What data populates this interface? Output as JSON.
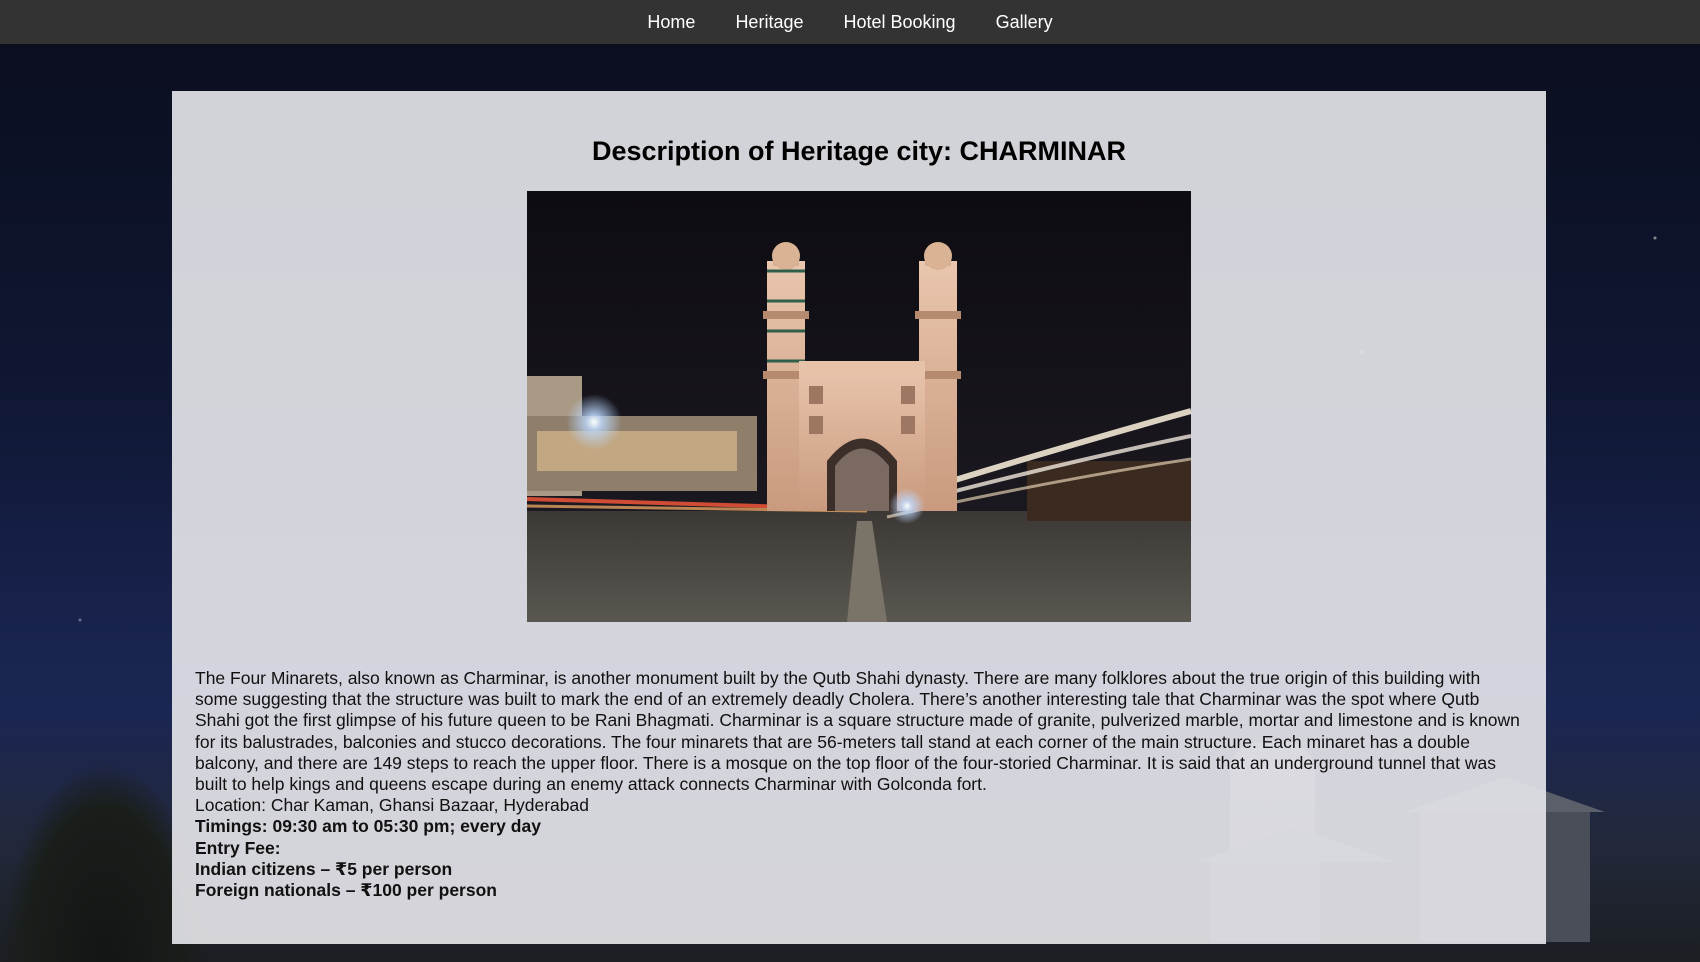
{
  "nav": {
    "items": [
      {
        "label": "Home"
      },
      {
        "label": "Heritage"
      },
      {
        "label": "Hotel Booking"
      },
      {
        "label": "Gallery"
      }
    ]
  },
  "main": {
    "title": "Description of Heritage city: CHARMINAR",
    "image": {
      "alt": "Charminar at night",
      "icon": "charminar-photo"
    },
    "description": "The Four Minarets, also known as Charminar, is another monument built by the Qutb Shahi dynasty. There are many folklores about the true origin of this building with some suggesting that the structure was built to mark the end of an extremely deadly Cholera. There’s another interesting tale that Charminar was the spot where Qutb Shahi got the first glimpse of his future queen to be Rani Bhagmati. Charminar is a square structure made of granite, pulverized marble, mortar and limestone and is known for its balustrades, balconies and stucco decorations. The four minarets that are 56-meters tall stand at each corner of the main structure. Each minaret has a double balcony, and there are 149 steps to reach the upper floor. There is a mosque on the top floor of the four-storied Charminar. It is said that an underground tunnel that was built to help kings and queens escape during an enemy attack connects Charminar with Golconda fort.",
    "location": "Location: Char Kaman, Ghansi Bazaar, Hyderabad",
    "timings": "Timings: 09:30 am to 05:30 pm; every day",
    "entry_fee_label": "Entry Fee:",
    "fee_indian": "Indian citizens – ₹5 per person",
    "fee_foreign": "Foreign nationals – ₹100 per person"
  },
  "colors": {
    "navbar": "#333333",
    "card": "#e2e2e7",
    "text": "#111111"
  }
}
